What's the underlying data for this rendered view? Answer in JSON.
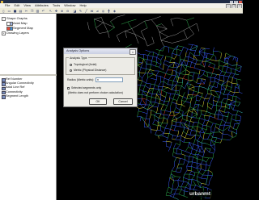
{
  "menu": [
    "File",
    "Edit",
    "View",
    "Attributes",
    "Tools",
    "Window",
    "Help"
  ],
  "toolbar": {
    "icons": [
      "new-icon",
      "open-icon",
      "save-icon",
      "print-icon",
      "cut-icon",
      "copy-icon",
      "paste-icon",
      "undo-icon",
      "select-icon",
      "pan-icon",
      "zoom-in-icon",
      "zoom-out-icon",
      "fill-icon",
      "pencil-icon",
      "line-icon",
      "join-icon",
      "unjoin-icon",
      "step-depth-icon",
      "axial-icon",
      "3d-view-icon"
    ]
  },
  "tree": {
    "items": [
      {
        "label": "Shape Graphs"
      },
      {
        "label": "Axial Map"
      },
      {
        "label": "Segment Map"
      },
      {
        "label": "Drawing Layers"
      }
    ]
  },
  "attributes": {
    "items": [
      "Ref Number",
      "Angular Connectivity",
      "Axial Line Ref",
      "Connectivity",
      "Segment Length"
    ]
  },
  "dialog": {
    "title": "Analysis Options",
    "group_label": "Analysis Type",
    "radio_topological": "Topological (Axial)",
    "radio_metric": "Metric (Physical Distance)",
    "topological_selected": true,
    "metric_selected": false,
    "radius_label": "Radius (Metric units):",
    "radius_value": "n",
    "checkbox_label": "Selected segments only",
    "checkbox_note": "(Metric does not perform choice calculation)",
    "checkbox_checked": false,
    "ok_label": "OK",
    "cancel_label": "Cancel"
  },
  "watermark": "urbanmt",
  "colors": {
    "canvas_background": "#000000",
    "dialog_background": "#ecebe6",
    "panel_background": "#ffffff"
  },
  "map": {
    "road_colors": {
      "blue": "#3a5cff",
      "green": "#2fb04e",
      "yellow": "#e6e23c",
      "red": "#e0452e",
      "cyan": "#3cc6c6",
      "grey": "#bdbdbd"
    }
  }
}
